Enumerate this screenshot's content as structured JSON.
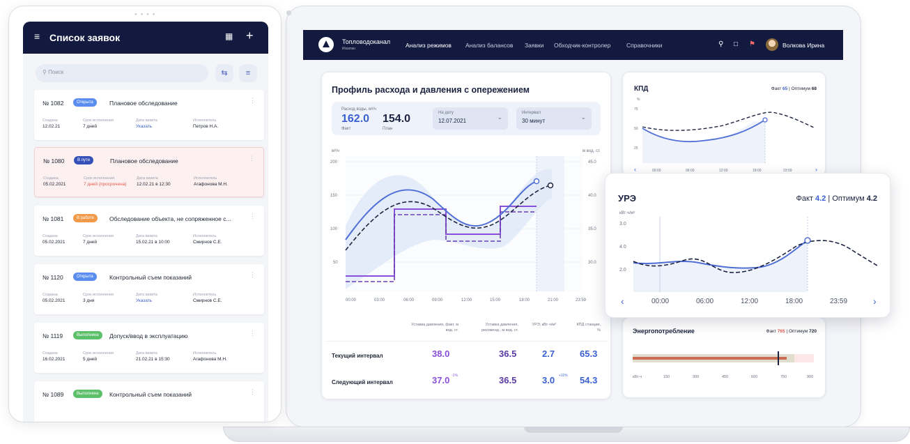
{
  "tablet": {
    "title": "Список заявок",
    "search_placeholder": "Поиск",
    "requests": [
      {
        "number": "№ 1082",
        "status": "Открыта",
        "status_color": "#5b8def",
        "title": "Плановое обследование",
        "fields": [
          {
            "k": "Создана",
            "v": "12.02.21"
          },
          {
            "k": "Срок исполнения",
            "v": "7 дней"
          },
          {
            "k": "Дата визита",
            "v": "Указать"
          },
          {
            "k": "Исполнитель",
            "v": "Петров Н.А."
          }
        ]
      },
      {
        "number": "№ 1080",
        "status": "В пути",
        "status_color": "#3550b8",
        "title": "Плановое обследование",
        "fields": [
          {
            "k": "Создана",
            "v": "05.02.2021"
          },
          {
            "k": "Срок исполнения",
            "v": "7 дней (просрочена)"
          },
          {
            "k": "Дата визита",
            "v": "12.02.21 в 12:30"
          },
          {
            "k": "Исполнитель",
            "v": "Агафонова М.Н."
          }
        ]
      },
      {
        "number": "№ 1081",
        "status": "В работе",
        "status_color": "#f29a4a",
        "title": "Обследование объекта, не сопряженное с...",
        "fields": [
          {
            "k": "Создана",
            "v": "05.02.2021"
          },
          {
            "k": "Срок исполнения",
            "v": "7 дней"
          },
          {
            "k": "Дата визита",
            "v": "15.02.21 в 10:00"
          },
          {
            "k": "Исполнитель",
            "v": "Смирнов С.Е."
          }
        ]
      },
      {
        "number": "№ 1120",
        "status": "Открыта",
        "status_color": "#5b8def",
        "title": "Контрольный съем показаний",
        "fields": [
          {
            "k": "Создана",
            "v": "05.02.2021"
          },
          {
            "k": "Срок исполнения",
            "v": "3 дня"
          },
          {
            "k": "Дата визита",
            "v": "Указать"
          },
          {
            "k": "Исполнитель",
            "v": "Смирнов С.Е."
          }
        ]
      },
      {
        "number": "№ 1119",
        "status": "Выполнена",
        "status_color": "#5cbf6a",
        "title": "Допуск/ввод в эксплуатацию",
        "fields": [
          {
            "k": "Создана",
            "v": "16.02.2021"
          },
          {
            "k": "Срок исполнения",
            "v": "5 дней"
          },
          {
            "k": "Дата визита",
            "v": "21.02.21 в 15:30"
          },
          {
            "k": "Исполнитель",
            "v": "Агафонова М.Н."
          }
        ]
      },
      {
        "number": "№ 1089",
        "status": "Выполнена",
        "status_color": "#5cbf6a",
        "title": "Контрольный съем показаний",
        "fields": []
      }
    ]
  },
  "app": {
    "brand": "Топловодоканал",
    "brand_sub": "Искатан",
    "nav": [
      "Анализ режимов",
      "Анализ балансов",
      "Заявки",
      "Обходчик-контролер",
      "Справочники"
    ],
    "user": "Волкова Ирина"
  },
  "profile": {
    "title": "Профиль расхода и давления с опережением",
    "flow_label": "Расход воды, м³/ч",
    "fact_value": "162.0",
    "fact_label": "Факт",
    "plan_value": "154.0",
    "plan_label": "План",
    "date_label": "На дату",
    "date_value": "12.07.2021",
    "interval_label": "Интервал",
    "interval_value": "30 минут",
    "left_unit": "м³/ч",
    "right_unit": "м вод. ст.",
    "y_left": [
      "200",
      "150",
      "100",
      "50"
    ],
    "y_right": [
      "45.0",
      "40.0",
      "35.0",
      "30.0"
    ],
    "x": [
      "00:00",
      "03:00",
      "06:00",
      "09:00",
      "12:00",
      "15:00",
      "18:00",
      "21:00",
      "23:59"
    ],
    "col_headers": [
      "Уставка давления, факт, м вод. ст.",
      "Уставка давления, рекоменд., м вод. ст.",
      "УРЭ, кВт·ч/м³",
      "КПД станции, %"
    ],
    "rows": [
      {
        "label": "Текущий интервал",
        "v1": "38.0",
        "v2": "36.5",
        "v3": "2.7",
        "v4": "65.3"
      },
      {
        "label": "Следующий интервал",
        "v1": "37.0",
        "v1_sup": "-1%",
        "v2": "36.5",
        "v3": "3.0",
        "v3_sup": "+11%",
        "v4": "54.3"
      }
    ]
  },
  "kpd": {
    "title": "КПД",
    "fact_label": "Факт",
    "fact_value": "65",
    "opt_label": "Оптимум",
    "opt_value": "68",
    "unit": "%",
    "y": [
      "75",
      "50",
      "25"
    ],
    "x": [
      "00:00",
      "06:00",
      "12:00",
      "18:00",
      "23:59"
    ]
  },
  "ure": {
    "title": "УРЭ",
    "fact_label": "Факт",
    "fact_value": "4.2",
    "opt_label": "Оптимум",
    "opt_value": "4.2",
    "unit": "кВт·ч/м³",
    "y": [
      "3.0",
      "4.0",
      "2.0"
    ],
    "x": [
      "00:00",
      "06:00",
      "12:00",
      "18:00",
      "23:59"
    ]
  },
  "energy": {
    "title": "Энергопотребление",
    "fact_label": "Факт",
    "fact_value": "765",
    "opt_label": "Оптимум",
    "opt_value": "720",
    "unit": "кВт·ч",
    "ticks": [
      "150",
      "300",
      "450",
      "600",
      "750",
      "900"
    ],
    "fact": 765,
    "max": 900
  },
  "colors": {
    "navy": "#121b3f",
    "blue": "#4f6fd6",
    "purple": "#8a4fd8",
    "red": "#e15b4c",
    "green": "#5cbf6a"
  }
}
